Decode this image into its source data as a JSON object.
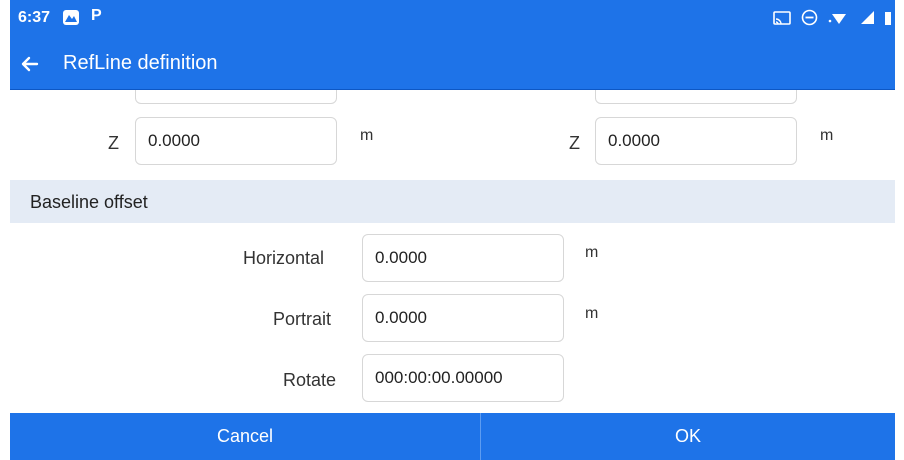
{
  "status_bar": {
    "time": "6:37",
    "app_icon_2": "P",
    "icons": [
      "cast-icon",
      "dnd-icon",
      "wifi-icon",
      "signal-icon",
      "battery-icon"
    ]
  },
  "app_bar": {
    "back_icon": "arrow-left-icon",
    "title": "RefLine definition"
  },
  "points": {
    "left": {
      "z_label": "Z",
      "z_value": "0.0000",
      "unit": "m"
    },
    "right": {
      "z_label": "Z",
      "z_value": "0.0000",
      "unit": "m"
    }
  },
  "baseline_offset": {
    "title": "Baseline offset",
    "horizontal": {
      "label": "Horizontal",
      "value": "0.0000",
      "unit": "m"
    },
    "portrait": {
      "label": "Portrait",
      "value": "0.0000",
      "unit": "m"
    },
    "rotate": {
      "label": "Rotate",
      "value": "000:00:00.00000"
    }
  },
  "buttons": {
    "cancel": "Cancel",
    "ok": "OK"
  },
  "colors": {
    "primary": "#1e73e8",
    "section_bg": "#e4ebf5"
  }
}
